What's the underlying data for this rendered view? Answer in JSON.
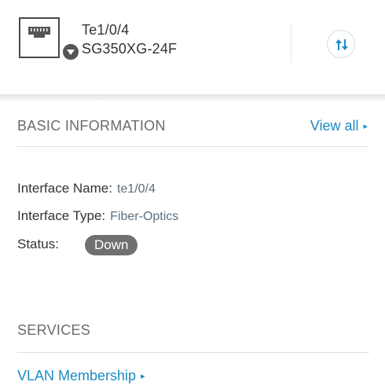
{
  "header": {
    "port_name": "Te1/0/4",
    "device_name": "SG350XG-24F",
    "port_icon": "ethernet-port-icon",
    "badge_icon": "chevron-down-icon",
    "action_icon": "sort-arrows-icon"
  },
  "basic_info": {
    "title": "BASIC INFORMATION",
    "view_all": "View all",
    "arrow": "▸",
    "interface_name_label": "Interface Name:",
    "interface_name_value": "te1/0/4",
    "interface_type_label": "Interface Type:",
    "interface_type_value": "Fiber-Optics",
    "status_label": "Status:",
    "status_value": "Down"
  },
  "services": {
    "title": "SERVICES",
    "vlan_link": "VLAN Membership",
    "arrow": "▸"
  },
  "colors": {
    "link": "#1e8bc3",
    "status_down": "#707070",
    "section_title": "#6b6b6b"
  }
}
